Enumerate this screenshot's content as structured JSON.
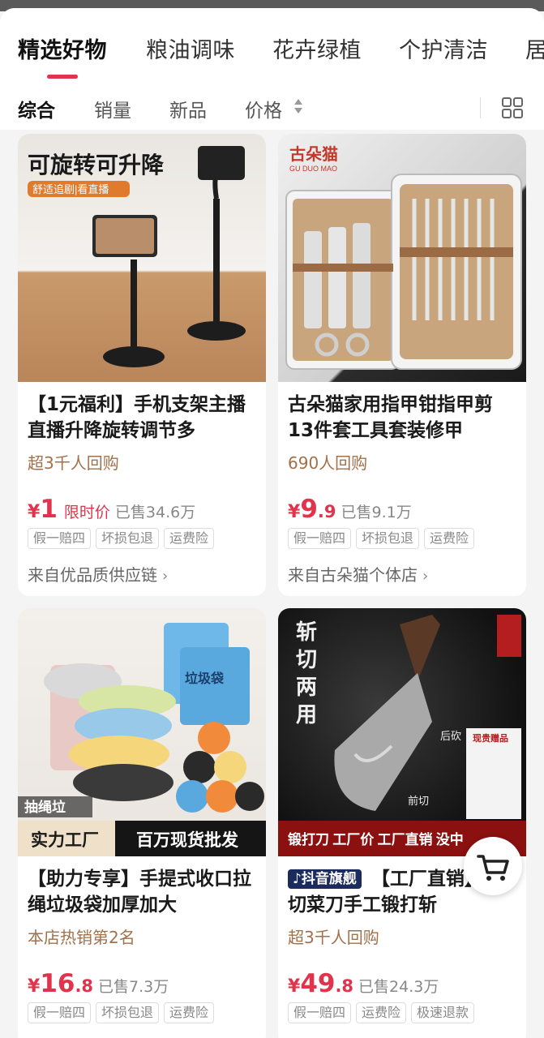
{
  "category_tabs": [
    {
      "label": "精选好物",
      "active": true
    },
    {
      "label": "粮油调味",
      "active": false
    },
    {
      "label": "花卉绿植",
      "active": false
    },
    {
      "label": "个护清洁",
      "active": false
    },
    {
      "label": "居",
      "active": false
    }
  ],
  "sort_options": [
    {
      "label": "综合",
      "active": true
    },
    {
      "label": "销量",
      "active": false
    },
    {
      "label": "新品",
      "active": false
    },
    {
      "label": "价格",
      "active": false
    }
  ],
  "products": [
    {
      "image_text": {
        "headline": "可旋转可升降",
        "sub": "舒适追剧|看直播"
      },
      "title": "【1元福利】手机支架主播直播升降旋转调节多",
      "tag": "超3千人回购",
      "price_symbol": "¥",
      "price_int": "1",
      "price_dec": "",
      "limit_label": "限时价",
      "sold": "已售34.6万",
      "badges": [
        "假一赔四",
        "坏损包退",
        "运费险"
      ],
      "shop": "来自优品质供应链"
    },
    {
      "image_text": {
        "brand": "古朵猫",
        "brand_sub": "GU DUO MAO"
      },
      "title": "古朵猫家用指甲钳指甲剪13件套工具套装修甲",
      "tag": "690人回购",
      "price_symbol": "¥",
      "price_int": "9",
      "price_dec": ".9",
      "limit_label": "",
      "sold": "已售9.1万",
      "badges": [
        "假一赔四",
        "坏损包退",
        "运费险"
      ],
      "shop": "来自古朵猫个体店"
    },
    {
      "image_text": {
        "corner": "抽绳垃",
        "bottom_left": "实力工厂",
        "bottom_right": "百万现货批发",
        "bag_label": "垃圾袋"
      },
      "title": "【助力专享】手提式收口拉绳垃圾袋加厚加大",
      "tag": "本店热销第2名",
      "price_symbol": "¥",
      "price_int": "16",
      "price_dec": ".8",
      "limit_label": "",
      "sold": "已售7.3万",
      "badges": [
        "假一赔四",
        "坏损包退",
        "运费险"
      ],
      "shop": ""
    },
    {
      "image_text": {
        "vertical": "斩切两用",
        "label_top": "后砍",
        "label_bottom": "前切",
        "banner": "锻打刀 工厂价  工厂直销  没中",
        "gift_title": "现贵赠品"
      },
      "store_badge": "抖音旗舰",
      "title": "【工厂直销】砍切菜刀手工锻打斩",
      "tag": "超3千人回购",
      "price_symbol": "¥",
      "price_int": "49",
      "price_dec": ".8",
      "limit_label": "",
      "sold": "已售24.3万",
      "badges": [
        "假一赔四",
        "运费险",
        "极速退款"
      ],
      "shop": ""
    }
  ],
  "colors": {
    "accent": "#e0344d",
    "tag": "#a0714a"
  },
  "icons": {
    "grid": "grid-view-icon",
    "cart": "cart-icon",
    "price_sort": "sort-arrows-icon"
  }
}
